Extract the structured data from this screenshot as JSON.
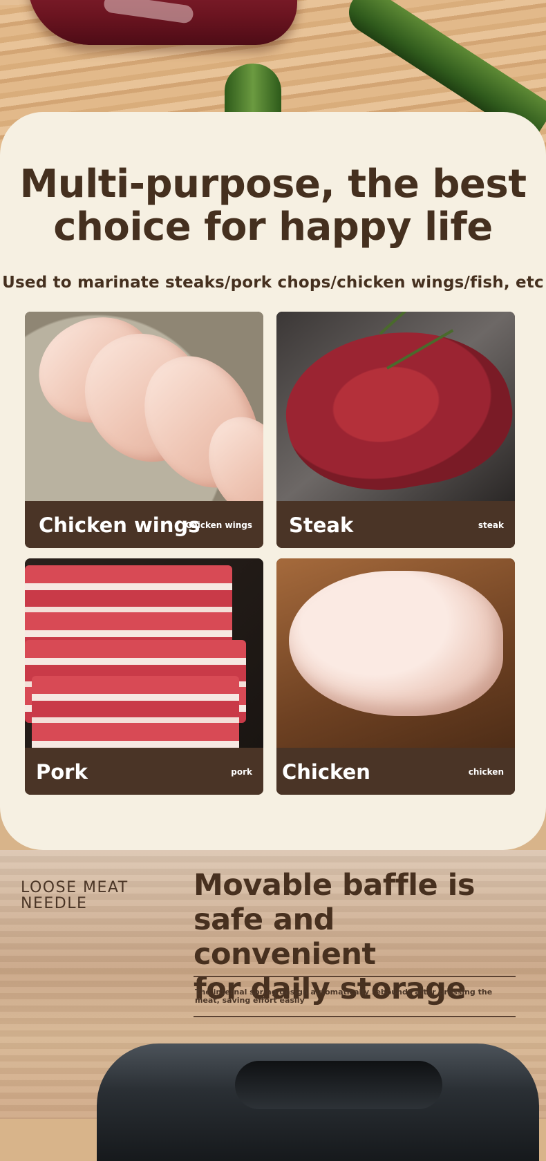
{
  "hero": {
    "headline_line1": "Multi-purpose, the best",
    "headline_line2": "choice for happy life",
    "subline": "Used to marinate steaks/pork chops/chicken wings/fish, etc"
  },
  "items": [
    {
      "name": "Chicken wings",
      "tag": "Chicken wings",
      "photo_icon": "chicken-wings-photo"
    },
    {
      "name": "Steak",
      "tag": "steak",
      "photo_icon": "steak-photo"
    },
    {
      "name": "Pork",
      "tag": "pork",
      "photo_icon": "pork-photo"
    },
    {
      "name": "Chicken",
      "tag": "chicken",
      "photo_icon": "whole-chicken-photo"
    }
  ],
  "feature": {
    "label_line1": "LOOSE MEAT",
    "label_line2": "NEEDLE",
    "title_line1": "Movable baffle is",
    "title_line2": "safe and convenient",
    "title_line3": "for daily storage",
    "description": "The internal spring design automatically rebounds after pressing the meat, saving effort easily"
  },
  "colors": {
    "card_background": "#f6f0e2",
    "text_brown": "#45301f",
    "label_bar": "#4a3426"
  }
}
